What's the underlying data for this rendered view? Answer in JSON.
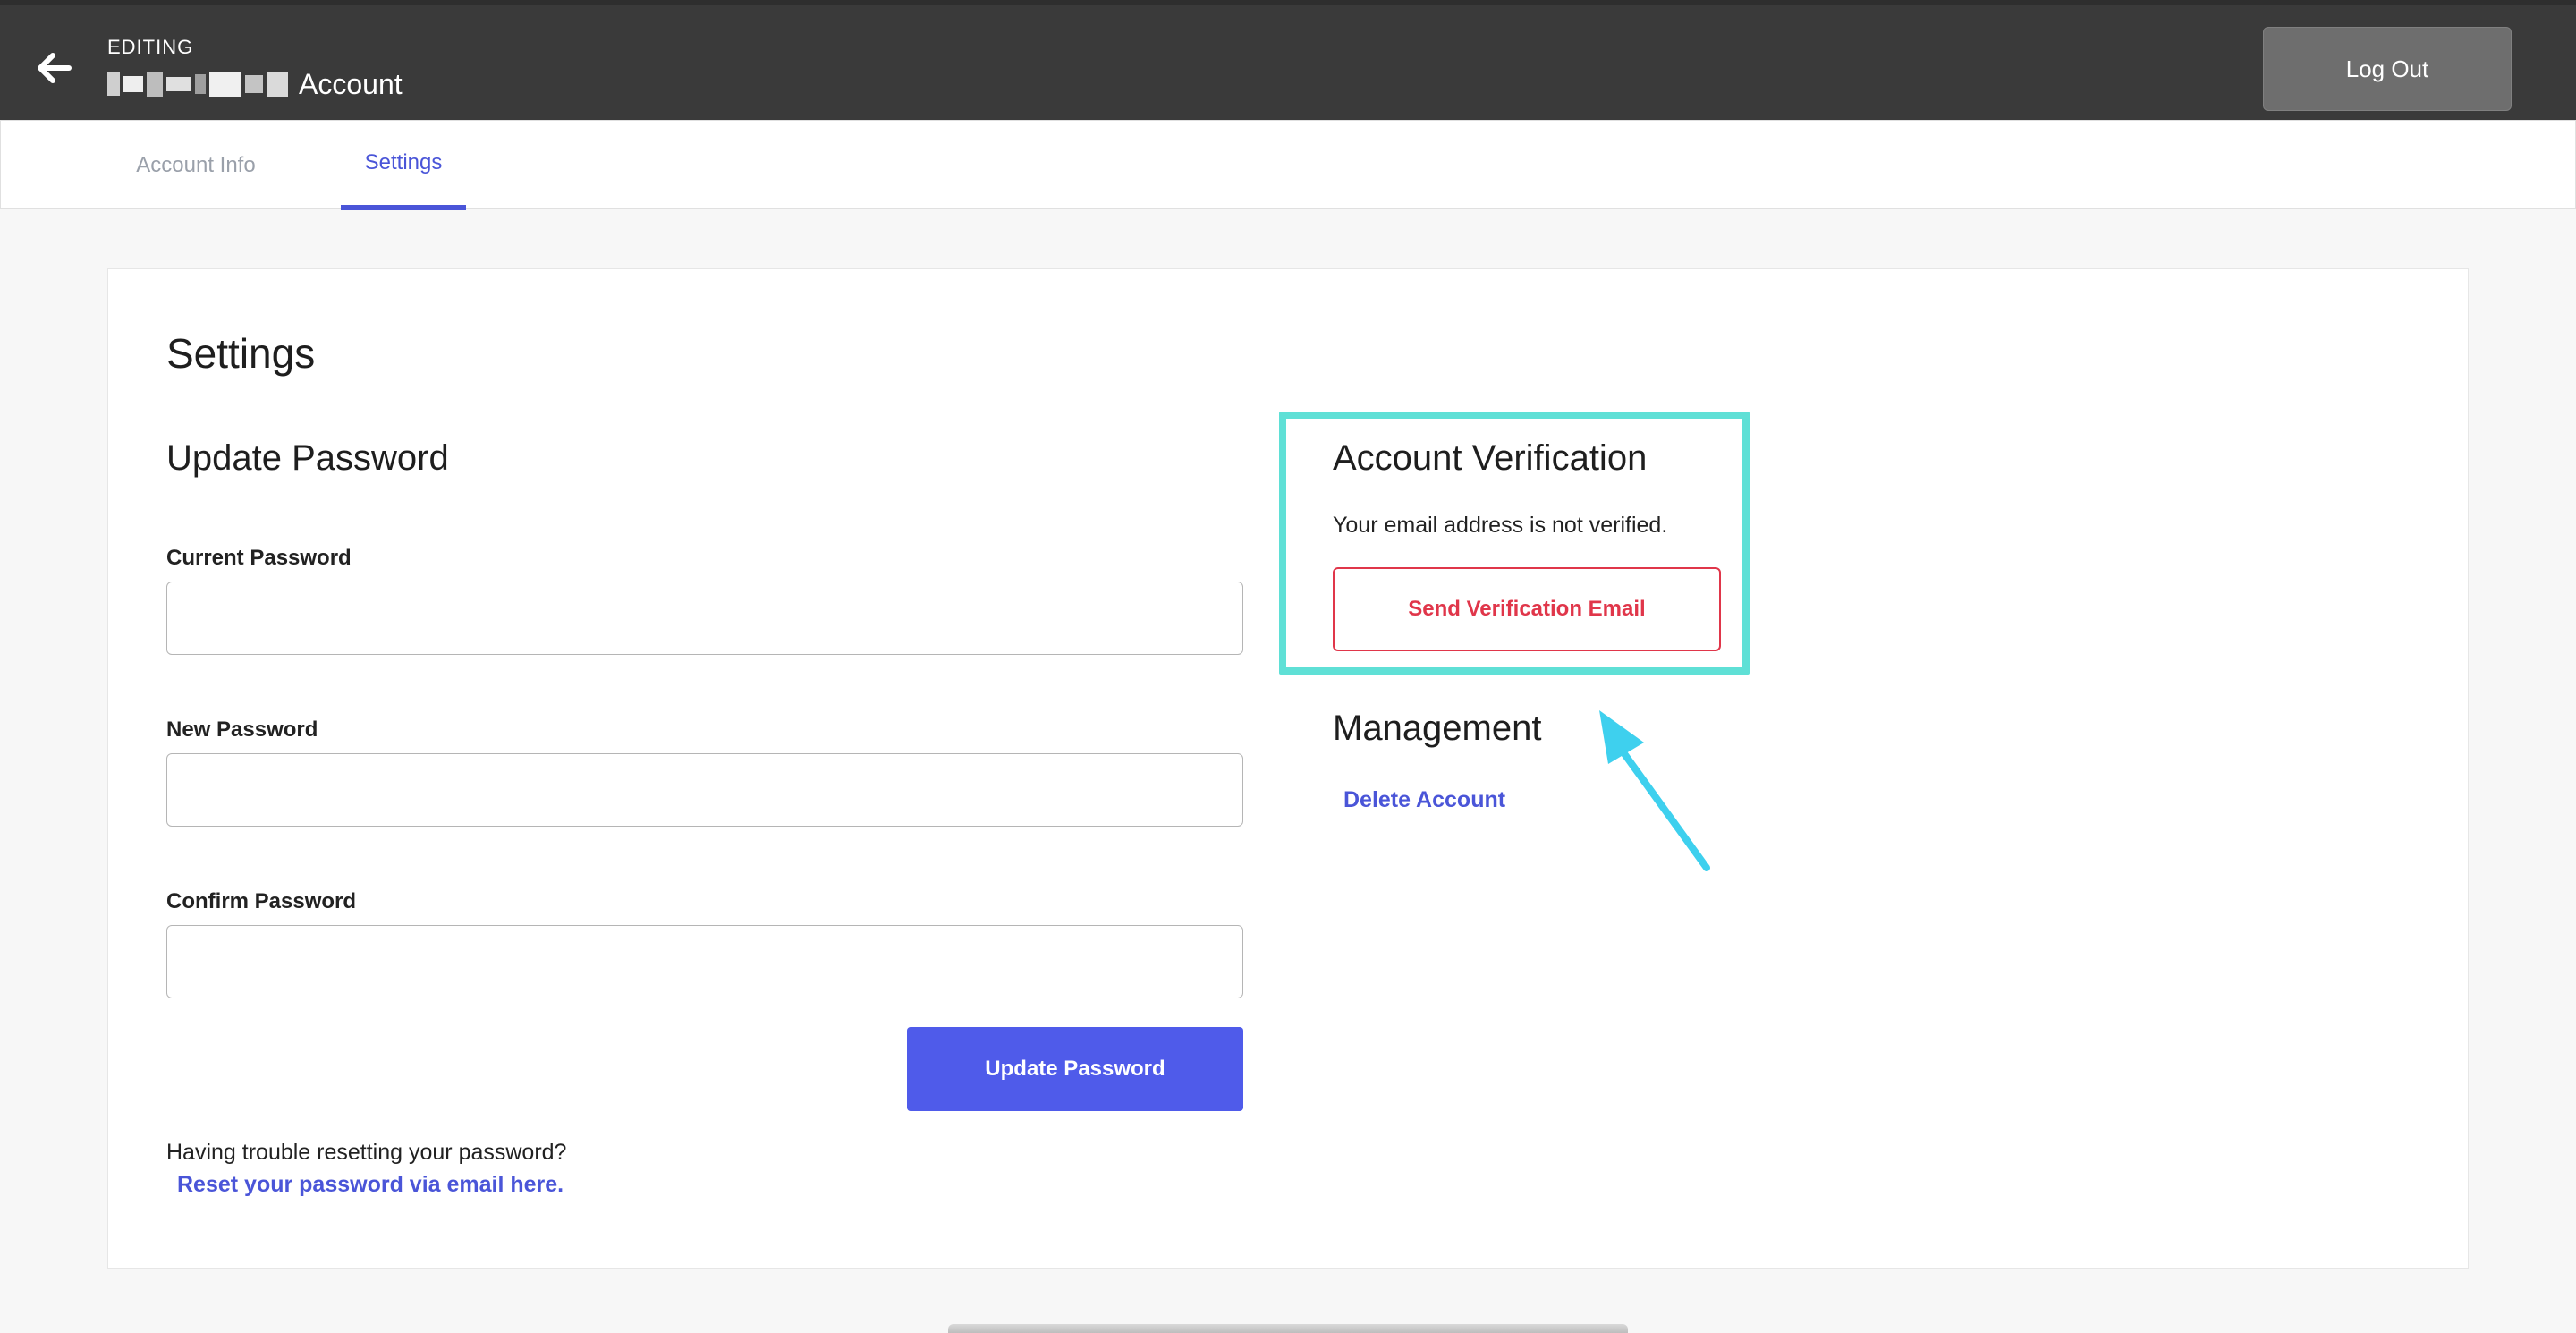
{
  "header": {
    "eyebrow": "EDITING",
    "title": "Account",
    "logout_label": "Log Out"
  },
  "tabs": [
    {
      "label": "Account Info",
      "active": false
    },
    {
      "label": "Settings",
      "active": true
    }
  ],
  "main": {
    "page_title": "Settings",
    "update_password": {
      "heading": "Update Password",
      "current_label": "Current Password",
      "current_value": "",
      "new_label": "New Password",
      "new_value": "",
      "confirm_label": "Confirm Password",
      "confirm_value": "",
      "submit_label": "Update Password",
      "help_text": "Having trouble resetting your password?",
      "reset_link": "Reset your password via email here."
    },
    "verification": {
      "heading": "Account Verification",
      "status": "Your email address is not verified.",
      "button_label": "Send Verification Email"
    },
    "management": {
      "heading": "Management",
      "delete_label": "Delete Account"
    }
  },
  "colors": {
    "accent": "#4f5bea",
    "danger": "#e0364a",
    "highlight": "#5fe0d6",
    "arrow": "#3ed0ee",
    "header_bg": "#3a3a3a"
  },
  "icons": {
    "back": "arrow-left-icon",
    "annotation": "annotation-arrow-icon"
  }
}
